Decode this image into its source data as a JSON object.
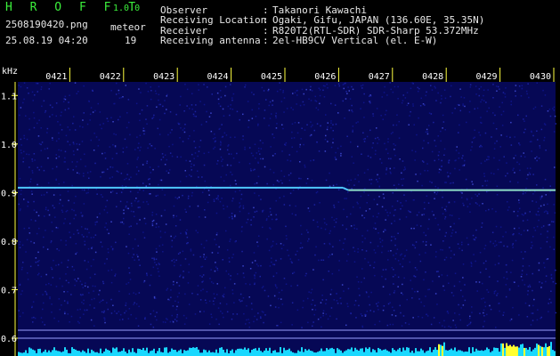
{
  "header": {
    "app_title": "H R O F F T",
    "version": "1.0.0",
    "file_name": "2508190420.png",
    "meteor_label": "meteor",
    "datetime": "25.08.19 04:20",
    "meteor_count": "19",
    "info": [
      {
        "key": "Observer",
        "value": "Takanori Kawachi"
      },
      {
        "key": "Receiving Location",
        "value": "Ogaki, Gifu, JAPAN (136.60E, 35.35N)"
      },
      {
        "key": "Receiver",
        "value": "R820T2(RTL-SDR) SDR-Sharp 53.372MHz"
      },
      {
        "key": "Receiving antenna",
        "value": "2el-HB9CV Vertical (el. E-W)"
      }
    ]
  },
  "colors": {
    "background": "#000000",
    "noise_base": "#07095a",
    "header_green": "#3cf03c",
    "tick_yellow": "#ffff40",
    "signal": "#4fc8ff",
    "spectrum": "#19d8ff",
    "spectrum_peak": "#ffff30"
  },
  "chart_data": {
    "type": "heatmap",
    "title": "",
    "ylabel": "kHz",
    "xlabel": "",
    "x_tick_labels": [
      "0421",
      "0422",
      "0423",
      "0424",
      "0425",
      "0426",
      "0427",
      "0428",
      "0429",
      "0430"
    ],
    "x_range_minutes": [
      4.333,
      4.5
    ],
    "y_tick_labels": [
      "1.1",
      "1.0",
      "0.9",
      "0.8",
      "0.7",
      "0.6"
    ],
    "y_range_khz": [
      0.6,
      1.15
    ],
    "carrier": {
      "description_values_khz": [
        0.91,
        0.905
      ],
      "time_break_label": "0426"
    }
  }
}
